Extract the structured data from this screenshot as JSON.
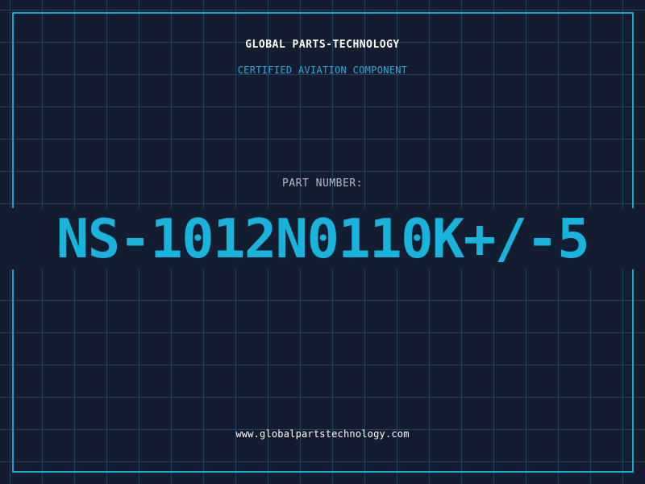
{
  "header": {
    "company": "GLOBAL PARTS-TECHNOLOGY",
    "tagline": "CERTIFIED AVIATION COMPONENT"
  },
  "part": {
    "label": "PART NUMBER:",
    "number": "NS-1012N0110K+/-5"
  },
  "footer": {
    "website": "www.globalpartstechnology.com"
  },
  "colors": {
    "background": "#141c30",
    "grid": "#22445c",
    "accent": "#1aa3cc",
    "part_number": "#18b4de"
  }
}
